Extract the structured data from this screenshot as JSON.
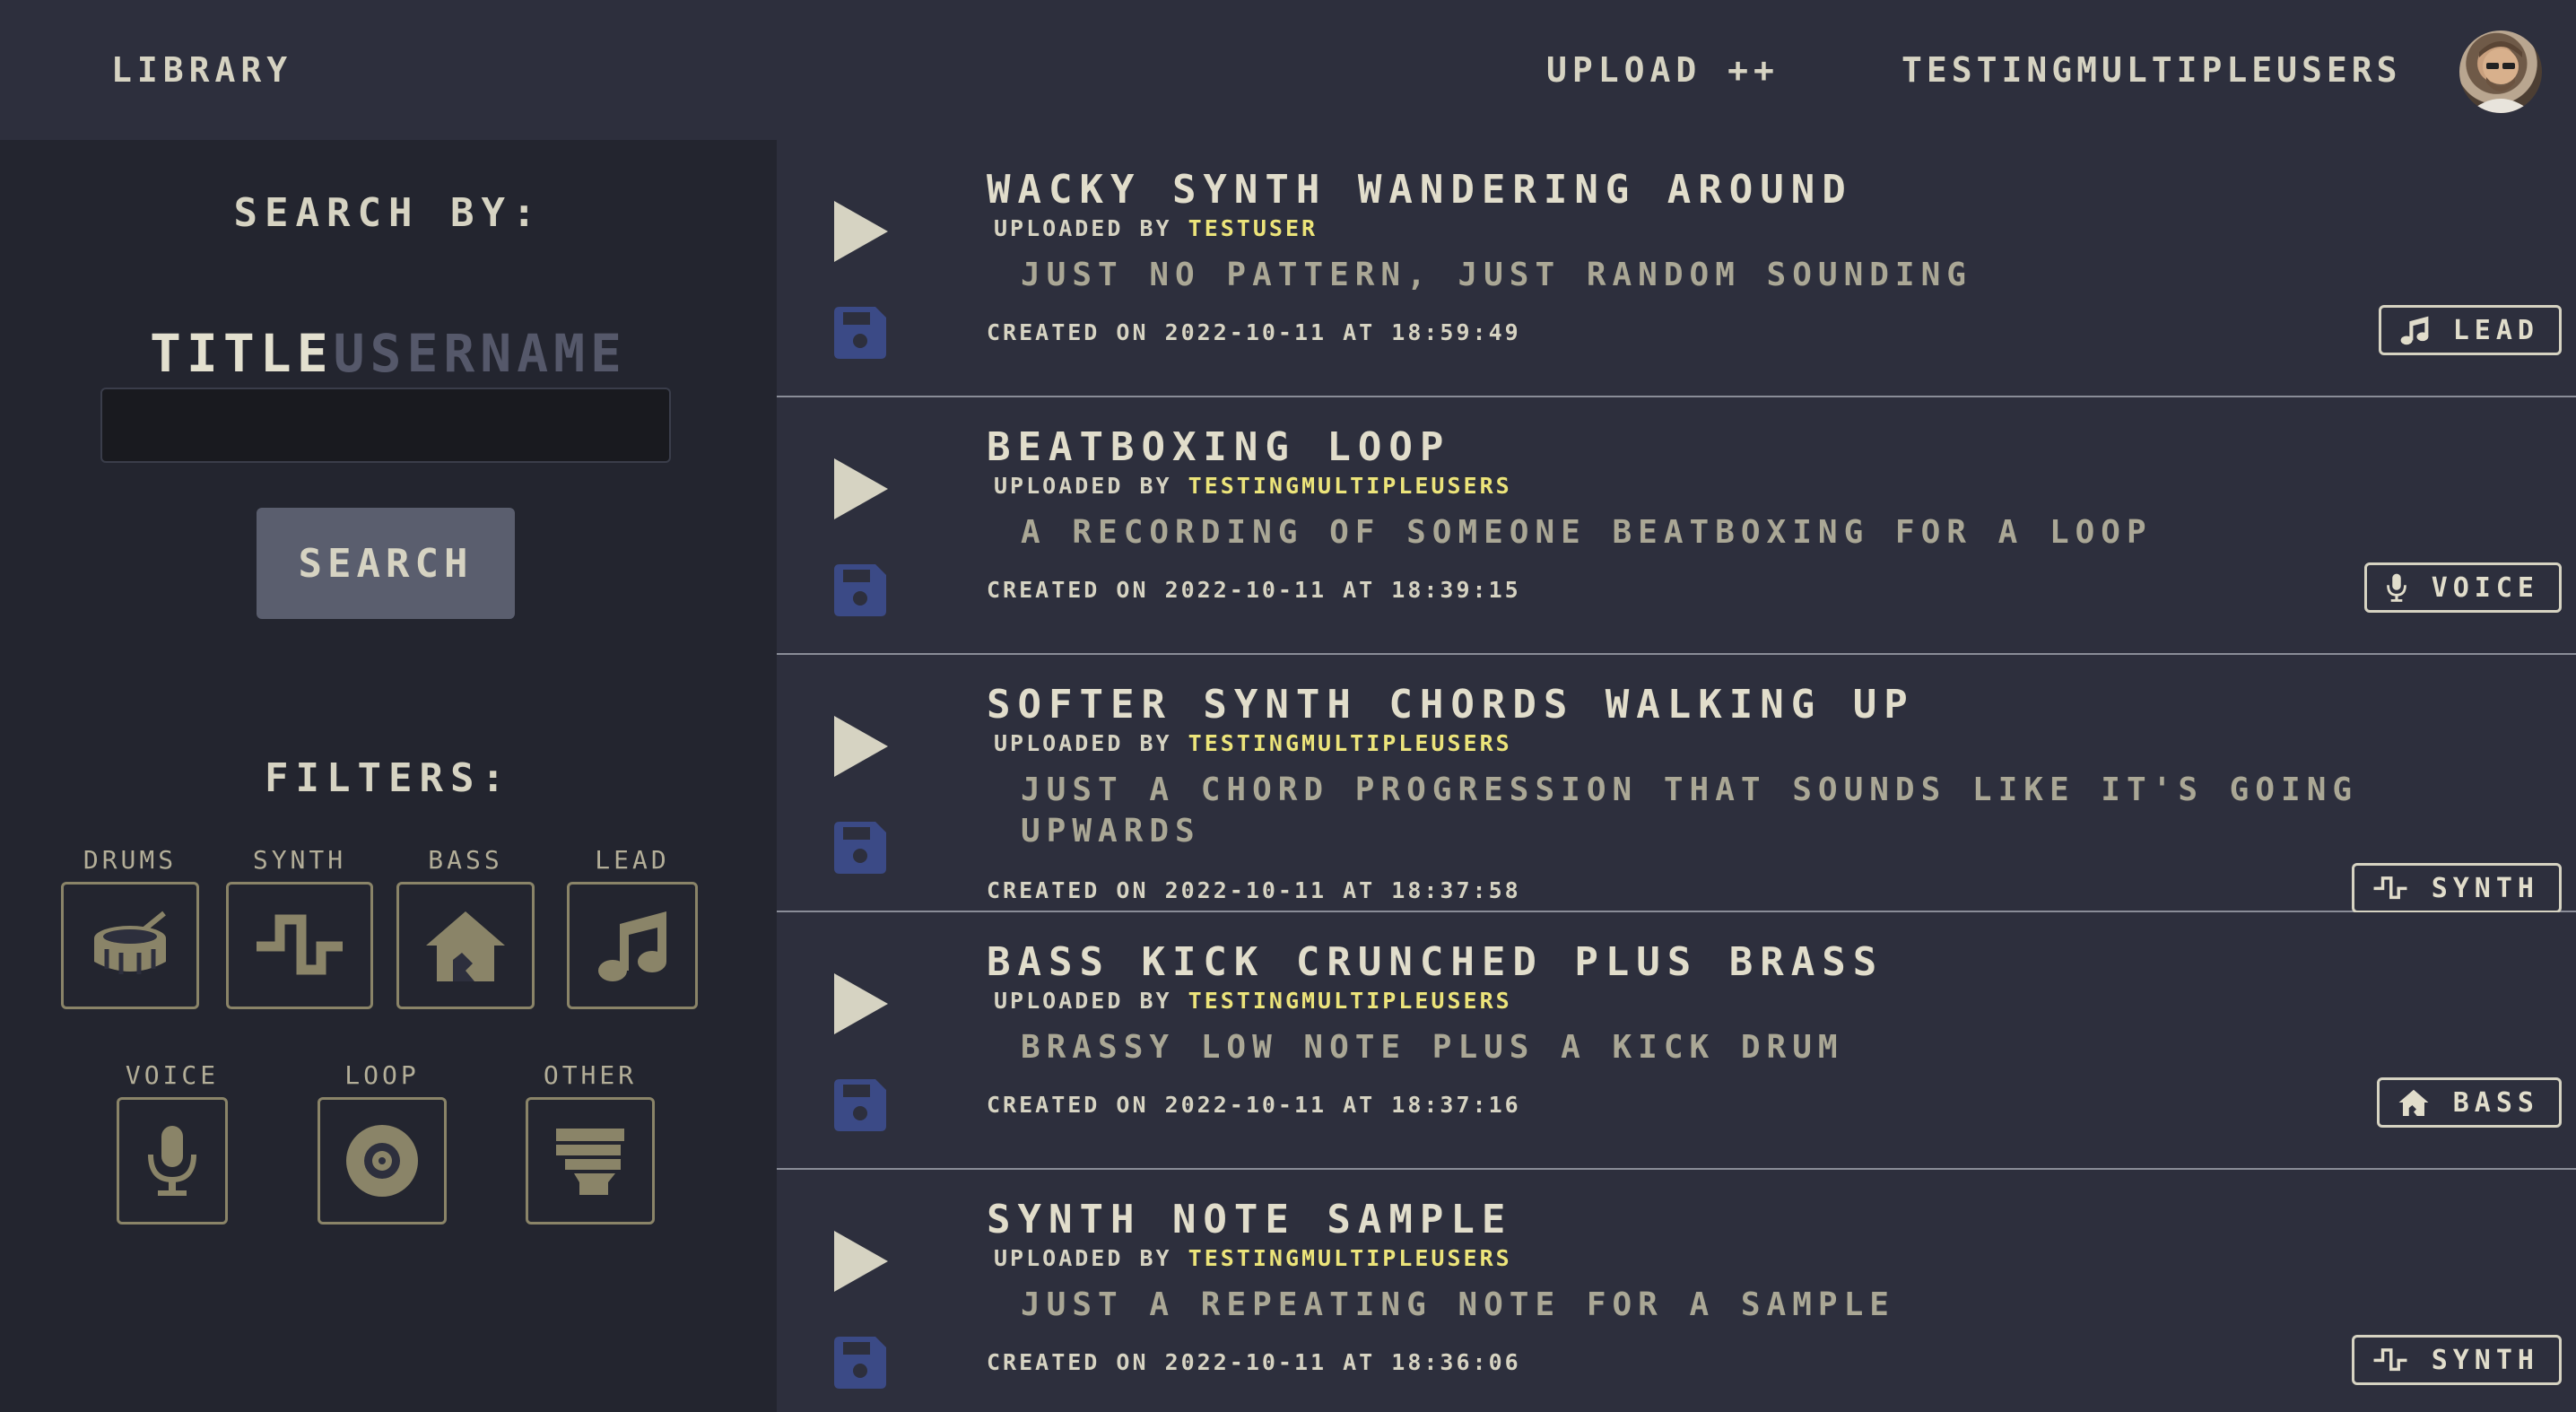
{
  "nav": {
    "library": "LIBRARY",
    "upload": "UPLOAD ++",
    "username": "TESTINGMULTIPLEUSERS"
  },
  "sidebar": {
    "search_heading": "SEARCH BY:",
    "toggle_title": "TITLE",
    "toggle_username": "USERNAME",
    "search_value": "",
    "search_button": "SEARCH",
    "filters_heading": "FILTERS:",
    "filters": [
      {
        "label": "DRUMS",
        "icon": "drum-icon"
      },
      {
        "label": "SYNTH",
        "icon": "square-wave-icon"
      },
      {
        "label": "BASS",
        "icon": "house-icon"
      },
      {
        "label": "LEAD",
        "icon": "music-note-icon"
      },
      {
        "label": "VOICE",
        "icon": "microphone-icon"
      },
      {
        "label": "LOOP",
        "icon": "record-icon"
      },
      {
        "label": "OTHER",
        "icon": "fist-icon"
      }
    ]
  },
  "colors": {
    "accent_username": "#ece47a",
    "save_icon": "#3b4a86",
    "filter_icon": "#8a8468"
  },
  "samples": [
    {
      "title": "WACKY SYNTH WANDERING AROUND",
      "uploaded_prefix": "UPLOADED BY",
      "uploader": "TESTUSER",
      "description": "JUST NO PATTERN, JUST RANDOM SOUNDING",
      "created": "CREATED ON 2022-10-11 AT 18:59:49",
      "tag": "LEAD",
      "tag_icon": "music-note-icon"
    },
    {
      "title": "BEATBOXING LOOP",
      "uploaded_prefix": "UPLOADED BY",
      "uploader": "TESTINGMULTIPLEUSERS",
      "description": "A RECORDING OF SOMEONE BEATBOXING FOR A LOOP",
      "created": "CREATED ON 2022-10-11 AT 18:39:15",
      "tag": "VOICE",
      "tag_icon": "microphone-icon"
    },
    {
      "title": "SOFTER SYNTH CHORDS WALKING UP",
      "uploaded_prefix": "UPLOADED BY",
      "uploader": "TESTINGMULTIPLEUSERS",
      "description": "JUST A CHORD PROGRESSION THAT SOUNDS LIKE IT'S GOING UPWARDS",
      "created": "CREATED ON 2022-10-11 AT 18:37:58",
      "tag": "SYNTH",
      "tag_icon": "square-wave-icon"
    },
    {
      "title": "BASS KICK CRUNCHED PLUS BRASS",
      "uploaded_prefix": "UPLOADED BY",
      "uploader": "TESTINGMULTIPLEUSERS",
      "description": "BRASSY LOW NOTE PLUS A KICK DRUM",
      "created": "CREATED ON 2022-10-11 AT 18:37:16",
      "tag": "BASS",
      "tag_icon": "house-icon"
    },
    {
      "title": "SYNTH NOTE SAMPLE",
      "uploaded_prefix": "UPLOADED BY",
      "uploader": "TESTINGMULTIPLEUSERS",
      "description": "JUST A REPEATING NOTE FOR A SAMPLE",
      "created": "CREATED ON 2022-10-11 AT 18:36:06",
      "tag": "SYNTH",
      "tag_icon": "square-wave-icon"
    }
  ]
}
